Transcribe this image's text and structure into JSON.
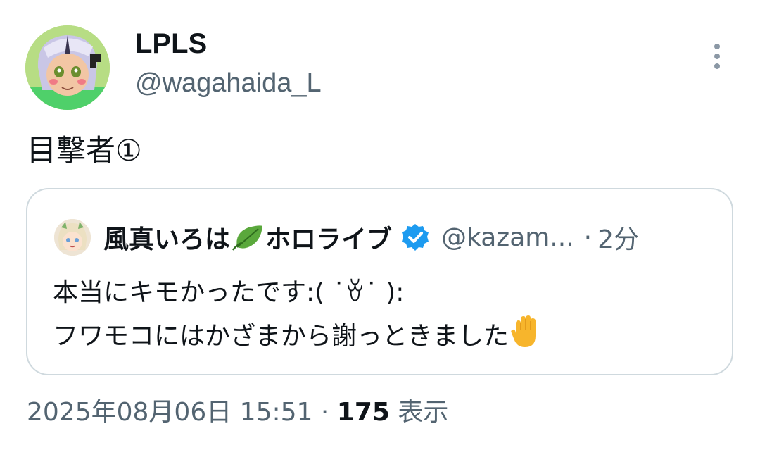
{
  "author": {
    "display_name": "LPLS",
    "handle": "@wagahaida_L"
  },
  "tweet": {
    "text": "目撃者①"
  },
  "quote": {
    "name": "風真いろは",
    "name_suffix": "ホロライブ",
    "handle": "@kazam...",
    "separator": "·",
    "time": "2分",
    "lines": [
      "本当にキモかったです:( ˙ꈊ˙ ):",
      "フワモコにはかざまから謝っときました"
    ]
  },
  "meta": {
    "timestamp": "2025年08月06日 15:51",
    "separator": "·",
    "views_count": "175",
    "views_label": "表示"
  },
  "icons": {
    "more": "more-vertical-icon",
    "verified": "verified-badge-icon",
    "leaf": "leaf-emoji-icon",
    "hand": "raised-hand-emoji-icon"
  },
  "colors": {
    "text_primary": "#0f1419",
    "text_secondary": "#536471",
    "border": "#cfd9de",
    "verified_blue": "#1d9bf0"
  }
}
